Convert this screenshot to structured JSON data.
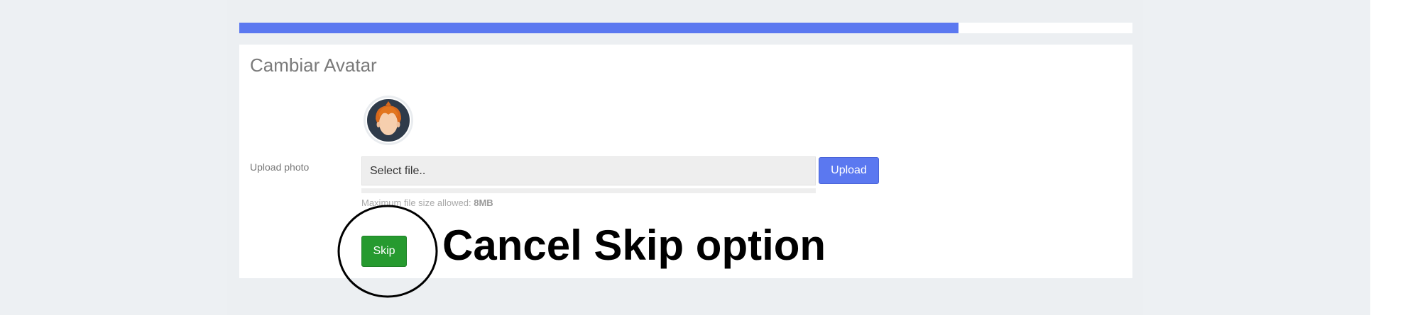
{
  "progress": {
    "percent": 80.5,
    "fill_color": "#5b78f0"
  },
  "card": {
    "title": "Cambiar Avatar"
  },
  "avatar": {
    "icon": "avatar-person-orange-hair"
  },
  "upload": {
    "label": "Upload photo",
    "file_placeholder": "Select file..",
    "button_label": "Upload",
    "size_note_prefix": "Maximum file size allowed:",
    "size_note_value": "8MB"
  },
  "skip": {
    "label": "Skip",
    "color": "#269a2f"
  },
  "annotation": {
    "text": "Cancel Skip option"
  }
}
